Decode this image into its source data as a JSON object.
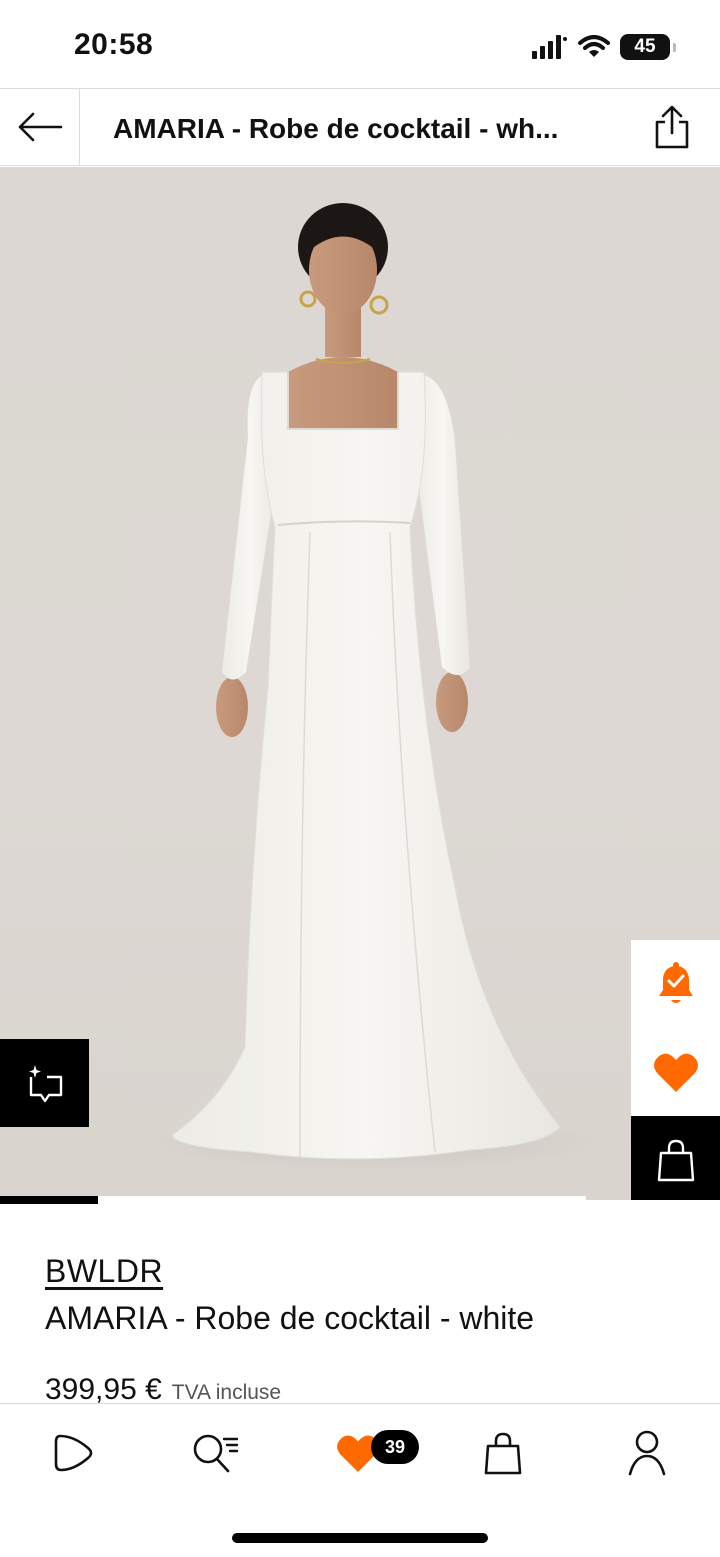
{
  "status_bar": {
    "time": "20:58",
    "battery": "45"
  },
  "header": {
    "title": "AMARIA - Robe de cocktail - wh...",
    "back_icon": "arrow-left-icon",
    "share_icon": "share-icon"
  },
  "gallery": {
    "image_description_icon": "product-photo",
    "progress": 0.167,
    "visual_search_icon": "visual-search-icon",
    "actions": [
      {
        "name": "alert-button",
        "icon": "bell-check-icon"
      },
      {
        "name": "wishlist-button",
        "icon": "heart-icon"
      },
      {
        "name": "add-to-bag-button",
        "icon": "bag-icon"
      }
    ]
  },
  "product": {
    "brand": "BWLDR",
    "name": "AMARIA - Robe de cocktail - white",
    "price": "399,95 €",
    "tax_note": "TVA incluse"
  },
  "bottom_nav": {
    "items": [
      {
        "name": "home",
        "icon": "play-home-icon"
      },
      {
        "name": "search",
        "icon": "search-icon"
      },
      {
        "name": "wishlist",
        "icon": "heart-icon"
      },
      {
        "name": "bag",
        "icon": "bag-icon"
      },
      {
        "name": "account",
        "icon": "user-icon"
      }
    ],
    "wishlist_count": "39"
  },
  "colors": {
    "accent": "#ff6900",
    "black": "#000000",
    "background": "#ffffff",
    "photo_bg": "#dcd7d2"
  }
}
